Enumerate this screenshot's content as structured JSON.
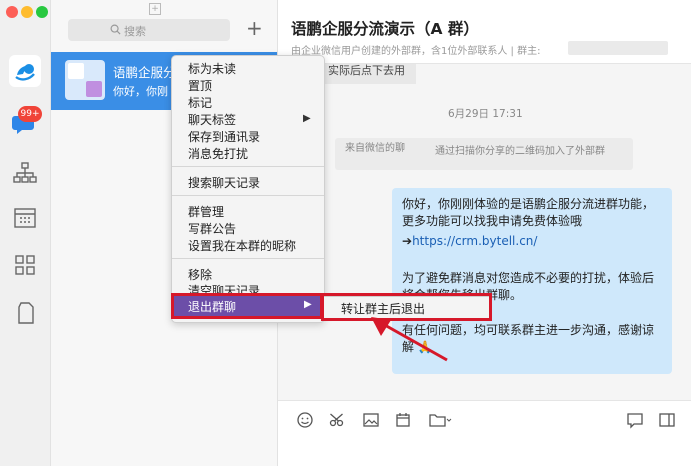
{
  "list": {
    "search_placeholder": "搜索"
  },
  "conversation": {
    "name": "语鹏企服分",
    "preview": "你好，你刚"
  },
  "rail": {
    "badge": "99+"
  },
  "chat": {
    "title": "语鹏企服分流演示（A 群）",
    "subtitle": "由企业微信用户创建的外部群，含1位外部联系人 | 群主:",
    "partial_top": "实际后点下去用",
    "timestamp": "6月29日 17:31",
    "sys_from": "来自微信的聊",
    "sys_text": "通过扫描你分享的二维码加入了外部群",
    "msg_p1": "你好，你刚刚体验的是语鹏企服分流进群功能，更多功能可以找我申请免费体验哦",
    "msg_link_arrow": "➔",
    "msg_link": "https://crm.bytell.cn/",
    "msg_p2": "为了避免群消息对您造成不必要的打扰，体验后将会帮您先移出群聊。",
    "msg_p3": "有任何问题，均可联系群主进一步沟通，感谢谅解 🙏"
  },
  "menu": {
    "mark_unread": "标为未读",
    "pin": "置顶",
    "mark": "标记",
    "chat_tags": "聊天标签",
    "save_contacts": "保存到通讯录",
    "mute": "消息免打扰",
    "search_history": "搜索聊天记录",
    "group_manage": "群管理",
    "write_notice": "写群公告",
    "set_nickname": "设置我在本群的昵称",
    "remove": "移除",
    "clear_history": "清空聊天记录",
    "exit_group": "退出群聊",
    "submenu_arrow": "▶",
    "transfer_exit": "转让群主后退出"
  },
  "colors": {
    "accent": "#3a8ee6",
    "highlight": "#6c4ea8",
    "annotation": "#d6182a"
  }
}
